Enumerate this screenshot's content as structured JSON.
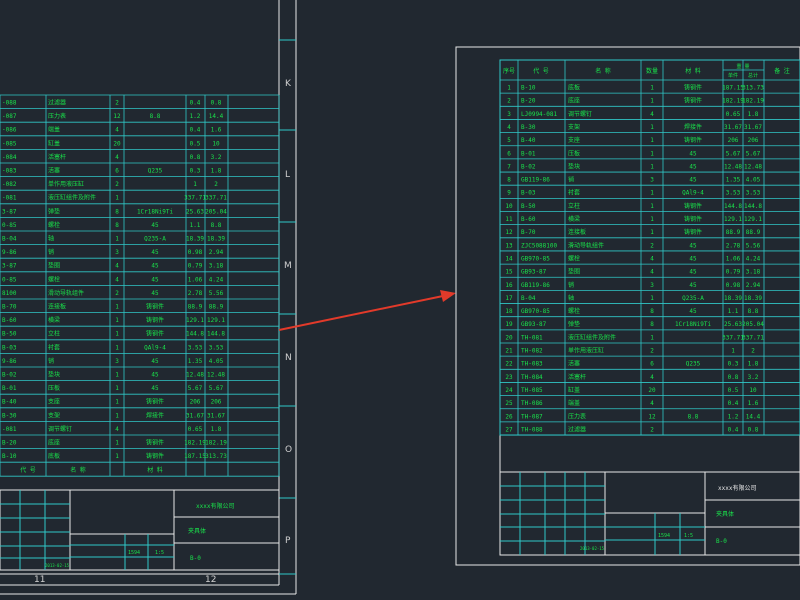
{
  "colors": {
    "background": "#212830",
    "frame_line": "#e8e8e8",
    "table_line": "#30c7c7",
    "text": "#19e34b",
    "arrow": "#e23a2a"
  },
  "zone_labels": {
    "right_col": [
      "K",
      "L",
      "M",
      "N",
      "O",
      "P"
    ],
    "bottom_row": [
      "11",
      "12"
    ]
  },
  "header": {
    "seq": "序号",
    "code": "代 号",
    "name": "名 称",
    "qty": "数量",
    "material": "材 料",
    "single": "单件",
    "total": "总计",
    "weight": "重 量",
    "remark": "备 注"
  },
  "rows": [
    {
      "no": "1",
      "code": "B-10",
      "name": "底板",
      "qty": "1",
      "mat": "铸钢件",
      "w1": "187.15",
      "w2": "313.73"
    },
    {
      "no": "2",
      "code": "B-20",
      "name": "底座",
      "qty": "1",
      "mat": "铸钢件",
      "w1": "182.19",
      "w2": "182.19"
    },
    {
      "no": "3",
      "code": "LJ0994-081",
      "name": "调节螺钉",
      "qty": "4",
      "mat": "",
      "w1": "0.65",
      "w2": "1.8"
    },
    {
      "no": "4",
      "code": "B-30",
      "name": "支架",
      "qty": "1",
      "mat": "焊接件",
      "w1": "31.67",
      "w2": "31.67"
    },
    {
      "no": "5",
      "code": "B-40",
      "name": "支座",
      "qty": "1",
      "mat": "铸钢件",
      "w1": "206",
      "w2": "206"
    },
    {
      "no": "6",
      "code": "B-01",
      "name": "压板",
      "qty": "1",
      "mat": "45",
      "w1": "5.67",
      "w2": "5.67"
    },
    {
      "no": "7",
      "code": "B-02",
      "name": "垫块",
      "qty": "1",
      "mat": "45",
      "w1": "12.48",
      "w2": "12.48"
    },
    {
      "no": "8",
      "code": "GB119-86",
      "name": "销",
      "qty": "3",
      "mat": "45",
      "w1": "1.35",
      "w2": "4.05"
    },
    {
      "no": "9",
      "code": "B-03",
      "name": "衬套",
      "qty": "1",
      "mat": "QAl9-4",
      "w1": "3.53",
      "w2": "3.53"
    },
    {
      "no": "10",
      "code": "B-50",
      "name": "立柱",
      "qty": "1",
      "mat": "铸钢件",
      "w1": "144.8",
      "w2": "144.8"
    },
    {
      "no": "11",
      "code": "B-60",
      "name": "横梁",
      "qty": "1",
      "mat": "铸钢件",
      "w1": "129.1",
      "w2": "129.1"
    },
    {
      "no": "12",
      "code": "B-70",
      "name": "连接板",
      "qty": "1",
      "mat": "铸钢件",
      "w1": "88.9",
      "w2": "88.9"
    },
    {
      "no": "13",
      "code": "ZJC5088100",
      "name": "滑动导轨组件",
      "qty": "2",
      "mat": "45",
      "w1": "2.78",
      "w2": "5.56"
    },
    {
      "no": "14",
      "code": "GB970-85",
      "name": "螺栓",
      "qty": "4",
      "mat": "45",
      "w1": "1.06",
      "w2": "4.24"
    },
    {
      "no": "15",
      "code": "GB93-87",
      "name": "垫圈",
      "qty": "4",
      "mat": "45",
      "w1": "0.79",
      "w2": "3.18"
    },
    {
      "no": "16",
      "code": "GB119-86",
      "name": "销",
      "qty": "3",
      "mat": "45",
      "w1": "0.98",
      "w2": "2.94"
    },
    {
      "no": "17",
      "code": "B-04",
      "name": "轴",
      "qty": "1",
      "mat": "Q235-A",
      "w1": "18.39",
      "w2": "18.39"
    },
    {
      "no": "18",
      "code": "GB970-85",
      "name": "螺栓",
      "qty": "8",
      "mat": "45",
      "w1": "1.1",
      "w2": "8.8"
    },
    {
      "no": "19",
      "code": "GB93-87",
      "name": "弹垫",
      "qty": "8",
      "mat": "1Cr18Ni9Ti",
      "w1": "25.63",
      "w2": "205.04"
    },
    {
      "no": "20",
      "code": "TH-081",
      "name": "液压缸组件及附件",
      "qty": "1",
      "mat": "",
      "w1": "337.71",
      "w2": "337.71"
    },
    {
      "no": "21",
      "code": "TH-082",
      "name": "单作用液压缸",
      "qty": "2",
      "mat": "",
      "w1": "1",
      "w2": "2"
    },
    {
      "no": "22",
      "code": "TH-083",
      "name": "活塞",
      "qty": "6",
      "mat": "Q235",
      "w1": "0.3",
      "w2": "1.8"
    },
    {
      "no": "23",
      "code": "TH-084",
      "name": "活塞杆",
      "qty": "4",
      "mat": "",
      "w1": "0.8",
      "w2": "3.2"
    },
    {
      "no": "24",
      "code": "TH-085",
      "name": "缸盖",
      "qty": "20",
      "mat": "",
      "w1": "0.5",
      "w2": "10"
    },
    {
      "no": "25",
      "code": "TH-086",
      "name": "端盖",
      "qty": "4",
      "mat": "",
      "w1": "0.4",
      "w2": "1.6"
    },
    {
      "no": "26",
      "code": "TH-087",
      "name": "压力表",
      "qty": "12",
      "mat": "8.8",
      "w1": "1.2",
      "w2": "14.4"
    },
    {
      "no": "27",
      "code": "TH-088",
      "name": "过滤器",
      "qty": "2",
      "mat": "",
      "w1": "0.4",
      "w2": "0.8"
    }
  ],
  "title_block": {
    "company": "xxxx有限公司",
    "drawing_name": "夹具体",
    "drawing_no": "B-0",
    "weight": "1594",
    "scale": "1:5",
    "date": "2013-02-15"
  }
}
